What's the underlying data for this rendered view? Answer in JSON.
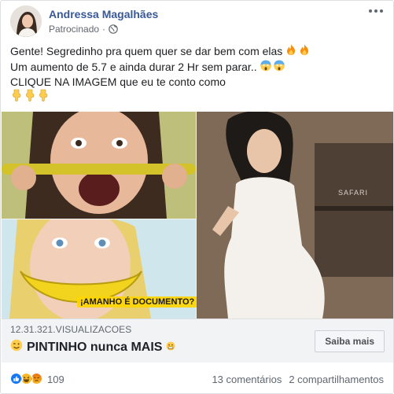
{
  "post": {
    "author": "Andressa Magalhães",
    "sponsored_label": "Patrocinado",
    "separator": "·",
    "text_lines": [
      "Gente! Segredinho pra quem quer se dar bem com elas",
      "Um aumento de 5.7 e ainda durar 2 Hr sem parar..",
      "CLIQUE NA IMAGEM que eu te conto como"
    ],
    "line_emojis": [
      [
        "fire",
        "fire"
      ],
      [
        "scream",
        "scream"
      ],
      [
        "point-down",
        "point-down",
        "point-down"
      ]
    ]
  },
  "media": {
    "caption": "¡AMANHO É DOCUMENTO?",
    "sign_text": "SAFARI"
  },
  "link": {
    "views": "12.31.321.VISUALIZACOES",
    "headline": "PINTINHO nunca MAIS",
    "cta": "Saiba mais"
  },
  "footer": {
    "reaction_types": [
      "like",
      "haha",
      "angry"
    ],
    "reaction_count": "109",
    "comments": "13 comentários",
    "shares": "2 compartilhamentos"
  },
  "colors": {
    "author_link": "#385898",
    "secondary_text": "#606770",
    "like": "#1877f2",
    "haha": "#f7b928",
    "angry": "#e9710f"
  }
}
